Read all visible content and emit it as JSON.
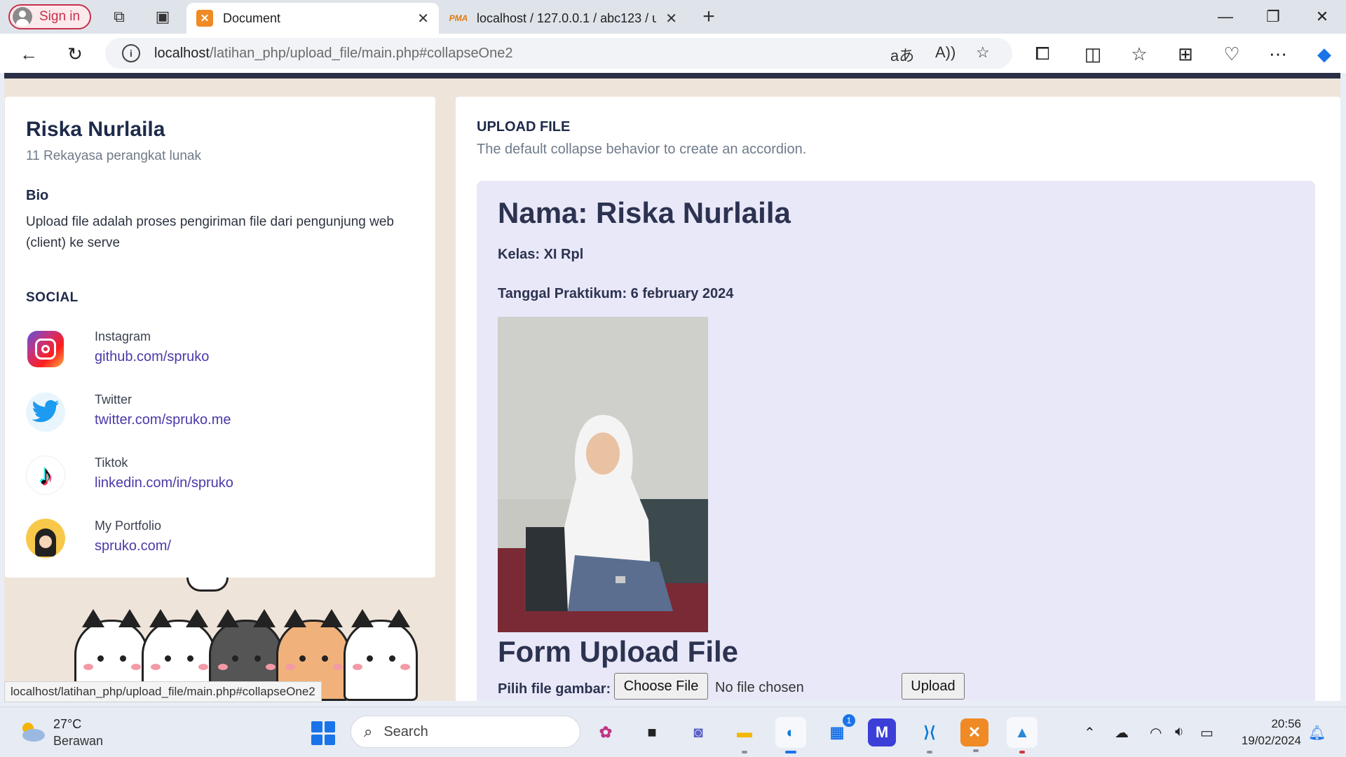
{
  "browser": {
    "signin_label": "Sign in",
    "tabs": [
      {
        "title": "Document",
        "active": true
      },
      {
        "title": "localhost / 127.0.0.1 / abc123 / u",
        "active": false
      }
    ],
    "url_host": "localhost",
    "url_path": "/latihan_php/upload_file/main.php#collapseOne2",
    "status_url": "localhost/latihan_php/upload_file/main.php#collapseOne2"
  },
  "profile": {
    "name": "Riska Nurlaila",
    "subtitle": "11 Rekayasa perangkat lunak",
    "bio_heading": "Bio",
    "bio_text": "Upload file adalah proses pengiriman file dari pengunjung web (client) ke serve",
    "social_heading": "SOCIAL",
    "social": [
      {
        "label": "Instagram",
        "link": "github.com/spruko",
        "icon": "instagram-icon"
      },
      {
        "label": "Twitter",
        "link": "twitter.com/spruko.me",
        "icon": "twitter-icon"
      },
      {
        "label": "Tiktok",
        "link": "linkedin.com/in/spruko",
        "icon": "tiktok-icon"
      },
      {
        "label": "My Portfolio",
        "link": "spruko.com/",
        "icon": "avatar-icon"
      }
    ]
  },
  "main": {
    "heading": "UPLOAD FILE",
    "description": "The default collapse behavior to create an accordion.",
    "nama": "Nama: Riska Nurlaila",
    "kelas": "Kelas: XI Rpl",
    "tanggal": "Tanggal Praktikum: 6 february 2024",
    "form_heading": "Form Upload File",
    "file_label": "Pilih file gambar:",
    "choose_button": "Choose File",
    "no_file": "No file chosen",
    "upload_button": "Upload"
  },
  "taskbar": {
    "temperature": "27°C",
    "weather": "Berawan",
    "search_label": "Search",
    "time": "20:56",
    "date": "19/02/2024",
    "store_badge": "1"
  },
  "colors": {
    "accent": "#4a3aa8",
    "heading": "#1e2a4a",
    "panel": "#e9e8f8"
  }
}
